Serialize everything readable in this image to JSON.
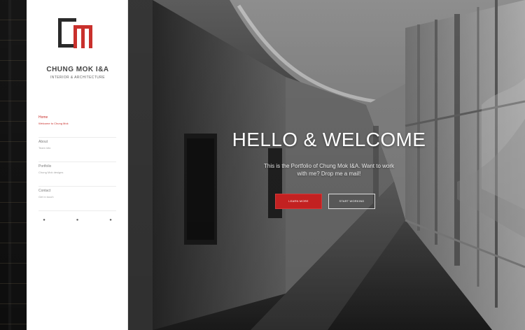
{
  "brand": {
    "name": "CHUNG MOK I&A",
    "subtitle": "INTERIOR & ARCHITECTURE",
    "logo_colors": {
      "dark": "#2a2a2a",
      "accent": "#c9302c"
    }
  },
  "sidebar": {
    "items": [
      {
        "title": "Home",
        "subtitle": "Welcome to Chung Mok"
      },
      {
        "title": "About",
        "subtitle": "Team info"
      },
      {
        "title": "Portfolio",
        "subtitle": "Chung Mok designs"
      },
      {
        "title": "Contact",
        "subtitle": "Get in touch"
      }
    ],
    "social_icons": [
      "facebook-icon",
      "twitter-icon",
      "instagram-icon"
    ],
    "social_glyphs": [
      "●",
      "●",
      "●"
    ]
  },
  "hero": {
    "title": "HELLO & WELCOME",
    "copy": "This is the Portfolio of Chung Mok I&A. Want to work with me? Drop me a mail!",
    "primary_button": "Learn more",
    "secondary_button": "Start working"
  },
  "colors": {
    "accent": "#c32121",
    "sidebar_bg": "#ffffff",
    "hero_text": "#ffffff"
  }
}
